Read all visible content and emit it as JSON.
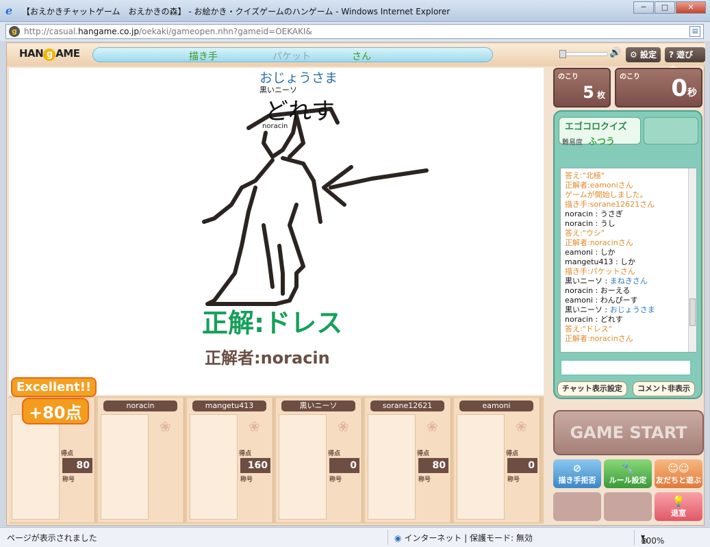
{
  "window": {
    "title": "【おえかきチャットゲーム　おえかきの森】 - お絵かき・クイズゲームのハンゲーム - Windows Internet Explorer",
    "controls": [
      "─",
      "□",
      "✕"
    ]
  },
  "address_bar": {
    "url_prefix": "http://casual.",
    "url_host": "hangame.co.jp",
    "url_path": "/oekaki/gameopen.nhn?gameid=OEKAKI&"
  },
  "header": {
    "logo": "Hangame",
    "status_labels": [
      "描き手",
      "パケット",
      "さん"
    ],
    "settings_label": "設定",
    "howto_label": "遊び方"
  },
  "canvas": {
    "drawer_name": "おじょうさま",
    "drawn_user": "黒いニーソ",
    "drawn_text": "どれす",
    "drawn_small": "noracin",
    "answer_text": "正解:ドレス",
    "solver_text": "正解者:noracin"
  },
  "remaining": {
    "cards_label": "のこり",
    "cards_value": "5",
    "cards_unit": "枚",
    "time_label": "のこり",
    "time_value": "0",
    "time_unit": "秒"
  },
  "quiz": {
    "title": "エゴコロクイズ",
    "difficulty_label": "難易度",
    "difficulty_value": "ふつう",
    "chat": [
      {
        "kind": "sys",
        "text": "答え:\"北極\""
      },
      {
        "kind": "sys",
        "text": "正解者:eamoniさん"
      },
      {
        "kind": "sys",
        "text": "ゲームが開始しました。"
      },
      {
        "kind": "sys",
        "text": "描き手:sorane12621さん"
      },
      {
        "kind": "u",
        "name": "noracin",
        "msg": "うさぎ"
      },
      {
        "kind": "u",
        "name": "noracin",
        "msg": "うし"
      },
      {
        "kind": "sys",
        "text": "答え:\"ウシ\""
      },
      {
        "kind": "sys",
        "text": "正解者:noracinさん"
      },
      {
        "kind": "u",
        "name": "eamoni",
        "msg": "しか"
      },
      {
        "kind": "u",
        "name": "mangetu413",
        "msg": "しか"
      },
      {
        "kind": "sys",
        "text": "描き手:パケットさん"
      },
      {
        "kind": "u",
        "name": "黒いニーソ",
        "msg": "まねきさん",
        "blue": true
      },
      {
        "kind": "u",
        "name": "noracin",
        "msg": "おーえる"
      },
      {
        "kind": "u",
        "name": "eamoni",
        "msg": "わんぴーす"
      },
      {
        "kind": "u",
        "name": "黒いニーソ",
        "msg": "おじょうさま",
        "blue": true
      },
      {
        "kind": "u",
        "name": "noracin",
        "msg": "どれす"
      },
      {
        "kind": "sys",
        "text": "答え:\"ドレス\""
      },
      {
        "kind": "sys",
        "text": "正解者:noracinさん"
      }
    ],
    "chat_settings_label": "チャット表示設定",
    "hide_comments_label": "コメント非表示"
  },
  "actions": {
    "game_start": "GAME START",
    "refuse_draw": "描き手拒否",
    "rule_settings": "ルール設定",
    "invite_friends": "友だちと遊ぶ",
    "leave_room": "退室"
  },
  "players": [
    {
      "name": "",
      "score": "",
      "title": "",
      "badge": "Excellent!!",
      "bonus": "+80点"
    },
    {
      "name": "noracin",
      "score": "",
      "title": ""
    },
    {
      "name": "mangetu413",
      "score": "160",
      "title": "称号"
    },
    {
      "name": "黒いニーソ",
      "score": "0",
      "title": "称号"
    },
    {
      "name": "sorane12621",
      "score": "80",
      "title": "称号"
    },
    {
      "name": "eamoni",
      "score": "0",
      "title": "称号"
    }
  ],
  "player_score_label": "得点",
  "first_score": "80",
  "first_title": "称号",
  "statusbar": {
    "left": "ページが表示されました",
    "zone": "インターネット | 保護モード: 無効",
    "zoom": "100%"
  },
  "colors": {
    "answer": "#16a05a",
    "solver": "#6b4e44",
    "system_chat": "#e08a2a",
    "accent_blue": "#2f78c0"
  }
}
